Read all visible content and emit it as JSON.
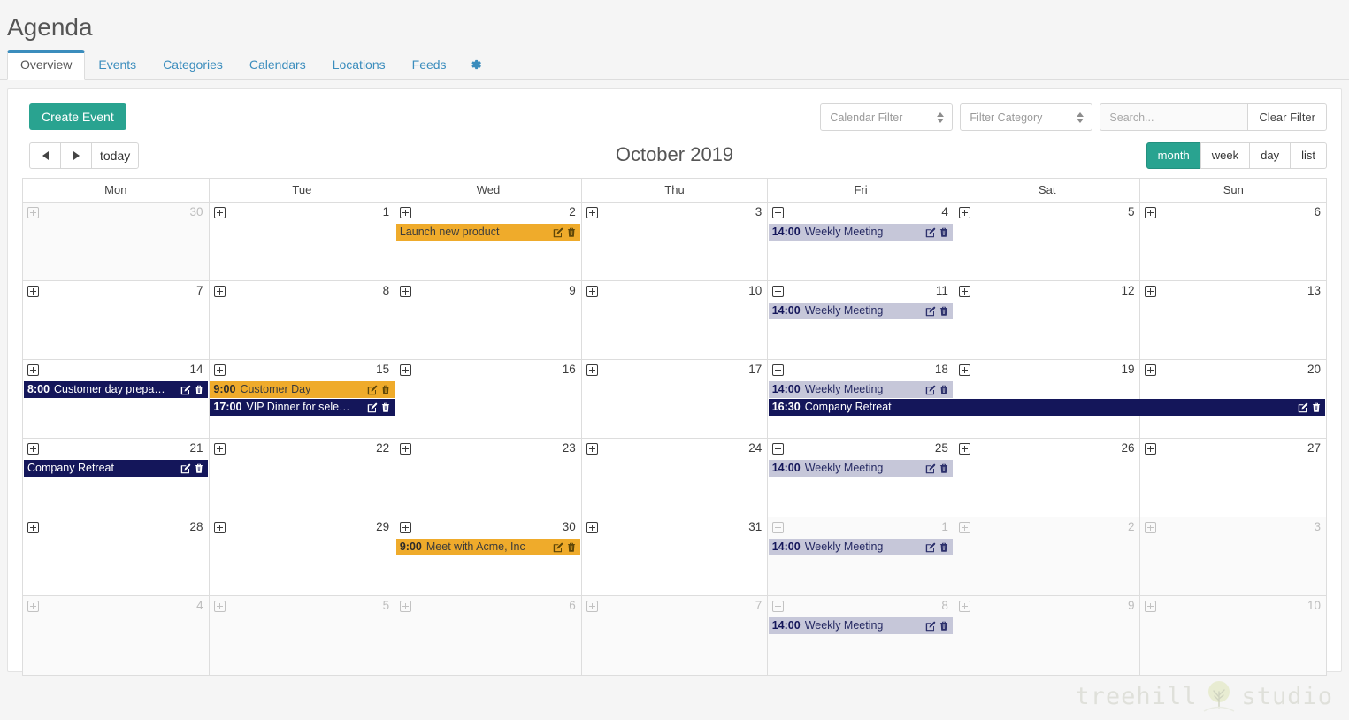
{
  "header": {
    "title": "Agenda",
    "tabs": [
      {
        "label": "Overview",
        "active": true
      },
      {
        "label": "Events",
        "active": false
      },
      {
        "label": "Categories",
        "active": false
      },
      {
        "label": "Calendars",
        "active": false
      },
      {
        "label": "Locations",
        "active": false
      },
      {
        "label": "Feeds",
        "active": false
      }
    ],
    "settings_icon": "gear-icon"
  },
  "toolbar": {
    "create_label": "Create Event",
    "calendar_filter": "Calendar Filter",
    "category_filter": "Filter Category",
    "search_value": "",
    "search_placeholder": "Search...",
    "clear_filter_label": "Clear Filter"
  },
  "calendar_header": {
    "prev_label": "‹",
    "next_label": "›",
    "today_label": "today",
    "title": "October 2019",
    "views": [
      {
        "label": "month",
        "active": true
      },
      {
        "label": "week",
        "active": false
      },
      {
        "label": "day",
        "active": false
      },
      {
        "label": "list",
        "active": false
      }
    ]
  },
  "colors": {
    "accent_teal": "#29a390",
    "link_blue": "#3b8dbd",
    "event_navy": "#14165a",
    "event_orange": "#efab2b",
    "event_lavender": "#c6c7d9"
  },
  "weekdays": [
    "Mon",
    "Tue",
    "Wed",
    "Thu",
    "Fri",
    "Sat",
    "Sun"
  ],
  "weeks": [
    {
      "days": [
        {
          "num": "30",
          "other": true
        },
        {
          "num": "1",
          "other": false
        },
        {
          "num": "2",
          "other": false
        },
        {
          "num": "3",
          "other": false
        },
        {
          "num": "4",
          "other": false
        },
        {
          "num": "5",
          "other": false
        },
        {
          "num": "6",
          "other": false
        }
      ],
      "events": [
        {
          "time": "",
          "title": "Launch new product",
          "style": "orange",
          "start": 2,
          "span": 1,
          "row": 0
        },
        {
          "time": "14:00",
          "title": "Weekly Meeting",
          "style": "lavender",
          "start": 4,
          "span": 1,
          "row": 0
        }
      ]
    },
    {
      "days": [
        {
          "num": "7",
          "other": false
        },
        {
          "num": "8",
          "other": false
        },
        {
          "num": "9",
          "other": false
        },
        {
          "num": "10",
          "other": false
        },
        {
          "num": "11",
          "other": false
        },
        {
          "num": "12",
          "other": false
        },
        {
          "num": "13",
          "other": false
        }
      ],
      "events": [
        {
          "time": "14:00",
          "title": "Weekly Meeting",
          "style": "lavender",
          "start": 4,
          "span": 1,
          "row": 0
        }
      ]
    },
    {
      "days": [
        {
          "num": "14",
          "other": false
        },
        {
          "num": "15",
          "other": false
        },
        {
          "num": "16",
          "other": false
        },
        {
          "num": "17",
          "other": false
        },
        {
          "num": "18",
          "other": false
        },
        {
          "num": "19",
          "other": false
        },
        {
          "num": "20",
          "other": false
        }
      ],
      "events": [
        {
          "time": "8:00",
          "title": "Customer day prepa…",
          "style": "navy",
          "start": 0,
          "span": 1,
          "row": 0
        },
        {
          "time": "9:00",
          "title": "Customer Day",
          "style": "orange",
          "start": 1,
          "span": 1,
          "row": 0
        },
        {
          "time": "17:00",
          "title": "VIP Dinner for sele…",
          "style": "navy",
          "start": 1,
          "span": 1,
          "row": 1
        },
        {
          "time": "14:00",
          "title": "Weekly Meeting",
          "style": "lavender",
          "start": 4,
          "span": 1,
          "row": 0
        },
        {
          "time": "16:30",
          "title": "Company Retreat",
          "style": "navy",
          "start": 4,
          "span": 3,
          "row": 1
        }
      ]
    },
    {
      "days": [
        {
          "num": "21",
          "other": false
        },
        {
          "num": "22",
          "other": false
        },
        {
          "num": "23",
          "other": false
        },
        {
          "num": "24",
          "other": false
        },
        {
          "num": "25",
          "other": false
        },
        {
          "num": "26",
          "other": false
        },
        {
          "num": "27",
          "other": false
        }
      ],
      "events": [
        {
          "time": "",
          "title": "Company Retreat",
          "style": "navy",
          "start": 0,
          "span": 1,
          "row": 0
        },
        {
          "time": "14:00",
          "title": "Weekly Meeting",
          "style": "lavender",
          "start": 4,
          "span": 1,
          "row": 0
        }
      ]
    },
    {
      "days": [
        {
          "num": "28",
          "other": false
        },
        {
          "num": "29",
          "other": false
        },
        {
          "num": "30",
          "other": false
        },
        {
          "num": "31",
          "other": false
        },
        {
          "num": "1",
          "other": true
        },
        {
          "num": "2",
          "other": true
        },
        {
          "num": "3",
          "other": true
        }
      ],
      "events": [
        {
          "time": "9:00",
          "title": "Meet with Acme, Inc",
          "style": "orange",
          "start": 2,
          "span": 1,
          "row": 0
        },
        {
          "time": "14:00",
          "title": "Weekly Meeting",
          "style": "lavender",
          "start": 4,
          "span": 1,
          "row": 0
        }
      ]
    },
    {
      "days": [
        {
          "num": "4",
          "other": true
        },
        {
          "num": "5",
          "other": true
        },
        {
          "num": "6",
          "other": true
        },
        {
          "num": "7",
          "other": true
        },
        {
          "num": "8",
          "other": true
        },
        {
          "num": "9",
          "other": true
        },
        {
          "num": "10",
          "other": true
        }
      ],
      "events": [
        {
          "time": "14:00",
          "title": "Weekly Meeting",
          "style": "lavender",
          "start": 4,
          "span": 1,
          "row": 0
        }
      ]
    }
  ],
  "footer": {
    "brand_left": "treehill",
    "brand_right": "studio",
    "logo_icon": "tree-icon"
  }
}
